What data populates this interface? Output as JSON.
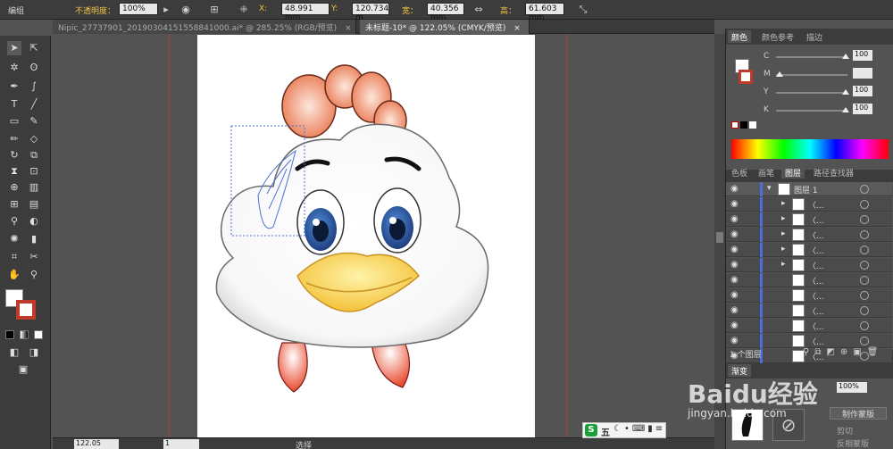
{
  "control_bar": {
    "group_label": "编组",
    "opacity_label": "不透明度：",
    "opacity_value": "100%",
    "x_label": "X:",
    "x_value": "48.991 mm",
    "y_label": "Y:",
    "y_value": "120.734 m",
    "w_label": "宽：",
    "w_value": "40.356 mm",
    "h_label": "高：",
    "h_value": "61.603 mm"
  },
  "tabs": [
    {
      "label": "Nipic_27737901_20190304151558841000.ai* @ 285.25% (RGB/预览)",
      "close": "×"
    },
    {
      "label": "未标题-10* @ 122.05% (CMYK/预览)",
      "close": "×"
    }
  ],
  "color_panel": {
    "tabs": [
      "颜色",
      "颜色参考",
      "描边"
    ],
    "channels": [
      {
        "name": "C",
        "value": "100",
        "level": 1.0
      },
      {
        "name": "M",
        "value": "",
        "level": 0.0
      },
      {
        "name": "Y",
        "value": "100",
        "level": 1.0
      },
      {
        "name": "K",
        "value": "100",
        "level": 1.0
      }
    ]
  },
  "layers_panel": {
    "tabs": [
      "色板",
      "画笔",
      "图层",
      "路径查找器"
    ],
    "top_layer": "图层 1",
    "rows": [
      "〈...",
      "〈...",
      "〈...",
      "〈...",
      "〈...",
      "〈...",
      "〈...",
      "〈...",
      "〈...",
      "〈...",
      "〈..."
    ],
    "footer": "1 个图层"
  },
  "transparency_panel": {
    "tab": "渐变",
    "opacity_value": "100%",
    "make_mask": "制作蒙版",
    "clip": "剪切",
    "invert": "反相蒙版"
  },
  "status_bar": {
    "zoom": "122.05",
    "page": "1",
    "tool": "选择"
  },
  "ime": {
    "logo": "S",
    "mode": "五"
  },
  "watermark": {
    "brand": "Baidu经验",
    "url": "jingyan.baidu.com"
  },
  "colors": {
    "accent": "#4a6fd8",
    "guide": "#c0392b",
    "comb": "#e8734a",
    "beak": "#f7d34a",
    "eye": "#2b5fa8"
  }
}
